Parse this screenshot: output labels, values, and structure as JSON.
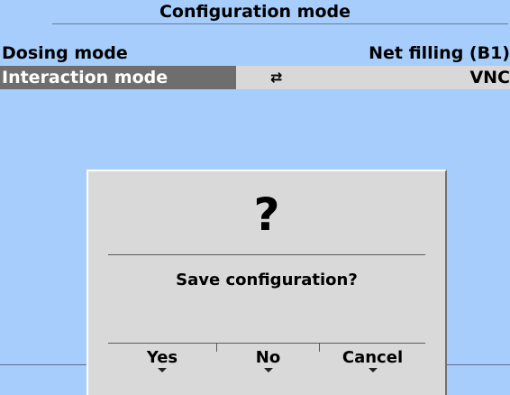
{
  "screen": {
    "title": "Configuration mode",
    "rows": [
      {
        "label": "Dosing mode",
        "value": "Net filling (B1)"
      },
      {
        "label": "Interaction mode",
        "icon": "swap-arrows-icon",
        "value": "VNC"
      }
    ]
  },
  "dialog": {
    "icon": "?",
    "message": "Save configuration?",
    "buttons": [
      {
        "label": "Yes"
      },
      {
        "label": "No"
      },
      {
        "label": "Cancel"
      }
    ]
  },
  "colors": {
    "background": "#a6cdfb",
    "selected_label_bg": "#6e6e6e",
    "dialog_bg": "#d9d9d9"
  }
}
